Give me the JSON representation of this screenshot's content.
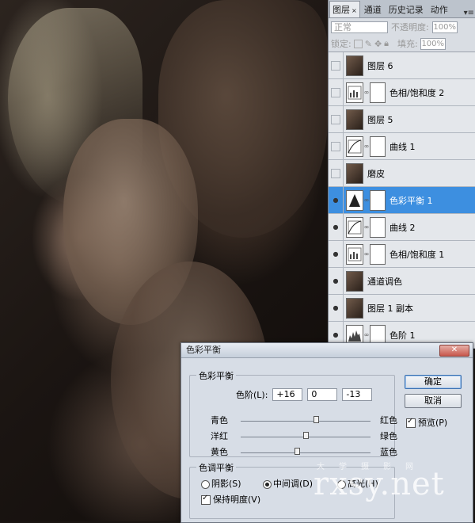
{
  "layers_panel": {
    "tabs": [
      {
        "label": "图层",
        "close": "×"
      },
      {
        "label": "通道"
      },
      {
        "label": "历史记录"
      },
      {
        "label": "动作"
      }
    ],
    "menu_icon": "panel-menu-icon",
    "blend_mode": "正常",
    "opacity_label": "不透明度:",
    "opacity_value": "100%",
    "lock_label": "锁定:",
    "fill_label": "填充:",
    "fill_value": "100%",
    "layers": [
      {
        "name": "图层 6",
        "visible": false,
        "kind": "photo",
        "selected": false
      },
      {
        "name": "色相/饱和度 2",
        "visible": false,
        "kind": "hue",
        "selected": false
      },
      {
        "name": "图层 5",
        "visible": false,
        "kind": "photo",
        "selected": false
      },
      {
        "name": "曲线 1",
        "visible": false,
        "kind": "curve",
        "selected": false
      },
      {
        "name": "磨皮",
        "visible": false,
        "kind": "photo",
        "selected": false
      },
      {
        "name": "色彩平衡 1",
        "visible": true,
        "kind": "balance",
        "selected": true
      },
      {
        "name": "曲线 2",
        "visible": true,
        "kind": "curve",
        "selected": false
      },
      {
        "name": "色相/饱和度 1",
        "visible": true,
        "kind": "hue",
        "selected": false
      },
      {
        "name": "通道调色",
        "visible": true,
        "kind": "photo",
        "selected": false
      },
      {
        "name": "图层 1 副本",
        "visible": true,
        "kind": "photo",
        "selected": false
      },
      {
        "name": "色阶 1",
        "visible": true,
        "kind": "levels",
        "selected": false
      }
    ]
  },
  "dialog": {
    "title": "色彩平衡",
    "close_icon": "close-icon",
    "balance_group_label": "色彩平衡",
    "levels_label": "色阶(L):",
    "levels_values": [
      "+16",
      "0",
      "-13"
    ],
    "sliders": [
      {
        "left": "青色",
        "right": "红色",
        "value": 16
      },
      {
        "left": "洋红",
        "right": "绿色",
        "value": 0
      },
      {
        "left": "黄色",
        "right": "蓝色",
        "value": -13
      }
    ],
    "tone_group_label": "色调平衡",
    "tone_options": [
      {
        "label": "阴影(S)",
        "checked": false
      },
      {
        "label": "中间调(D)",
        "checked": true
      },
      {
        "label": "高光(H)",
        "checked": false
      }
    ],
    "preserve_label": "保持明度(V)",
    "preserve_checked": true,
    "ok_label": "确定",
    "cancel_label": "取消",
    "preview_label": "预览(P)",
    "preview_checked": true
  },
  "watermark": {
    "text": "rxsy.net",
    "small": "大学摄影网"
  }
}
